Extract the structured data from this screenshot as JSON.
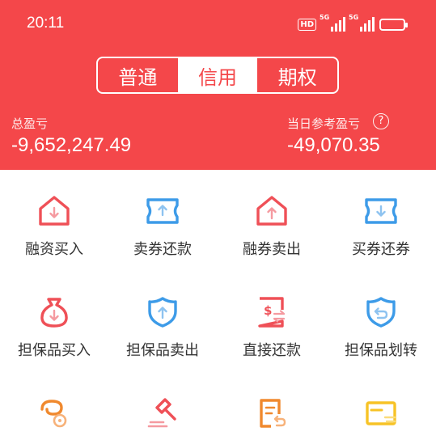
{
  "status_bar": {
    "time": "20:11",
    "hd_badge": "HD",
    "signal1_label": "5G",
    "signal2_label": "5G"
  },
  "account_tabs": [
    {
      "label": "普通",
      "active": false
    },
    {
      "label": "信用",
      "active": true
    },
    {
      "label": "期权",
      "active": false
    }
  ],
  "summary": {
    "total_pl_label": "总盈亏",
    "total_pl_value": "-9,652,247.49",
    "today_pl_label": "当日参考盈亏",
    "today_pl_value": "-49,070.35",
    "help_glyph": "?"
  },
  "actions": [
    {
      "label": "融资买入",
      "icon": "house-down-icon"
    },
    {
      "label": "卖券还款",
      "icon": "ticket-up-icon"
    },
    {
      "label": "融券卖出",
      "icon": "house-up-icon"
    },
    {
      "label": "买券还券",
      "icon": "ticket-down-icon"
    },
    {
      "label": "担保品买入",
      "icon": "moneybag-down-icon"
    },
    {
      "label": "担保品卖出",
      "icon": "shield-up-icon"
    },
    {
      "label": "直接还款",
      "icon": "dollar-doc-icon"
    },
    {
      "label": "担保品划转",
      "icon": "shield-return-icon"
    },
    {
      "label": "",
      "icon": "coin-swirl-icon"
    },
    {
      "label": "",
      "icon": "gavel-icon"
    },
    {
      "label": "",
      "icon": "doc-return-icon"
    },
    {
      "label": "",
      "icon": "card-icon"
    }
  ],
  "colors": {
    "brand_red": "#f4474a",
    "icon_red": "#ef5057",
    "icon_blue": "#3d9be8",
    "icon_orange": "#f0892e",
    "icon_yellow": "#f7c326"
  }
}
